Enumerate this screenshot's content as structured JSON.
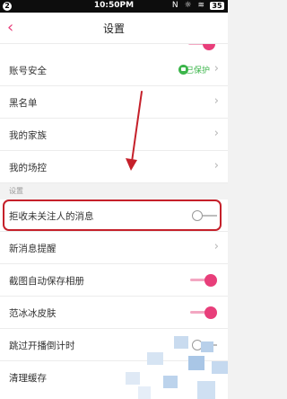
{
  "status_bar": {
    "notification_badge": "2",
    "time": "10:50PM",
    "icons": "N ☼ ≋",
    "battery": "35"
  },
  "nav": {
    "back_icon": "chevron-left-icon",
    "title": "设置"
  },
  "settings": {
    "account_security": {
      "label": "账号安全",
      "status_text": "已保护"
    },
    "blacklist": {
      "label": "黑名单"
    },
    "my_family": {
      "label": "我的家族"
    },
    "my_control": {
      "label": "我的场控"
    },
    "section_header": "设置",
    "reject_strangers": {
      "label": "拒收未关注人的消息",
      "enabled": false
    },
    "new_message_alert": {
      "label": "新消息提醒"
    },
    "screenshot_save": {
      "label": "截图自动保存相册",
      "enabled": true
    },
    "fanbingbing_skin": {
      "label": "范冰冰皮肤",
      "enabled": true
    },
    "skip_countdown": {
      "label": "跳过开播倒计时",
      "enabled": false
    },
    "clear_cache": {
      "label": "清理缓存"
    }
  },
  "colors": {
    "accent": "#e83e7a",
    "protect_green": "#3bb54a",
    "annotation_red": "#c5202a"
  }
}
